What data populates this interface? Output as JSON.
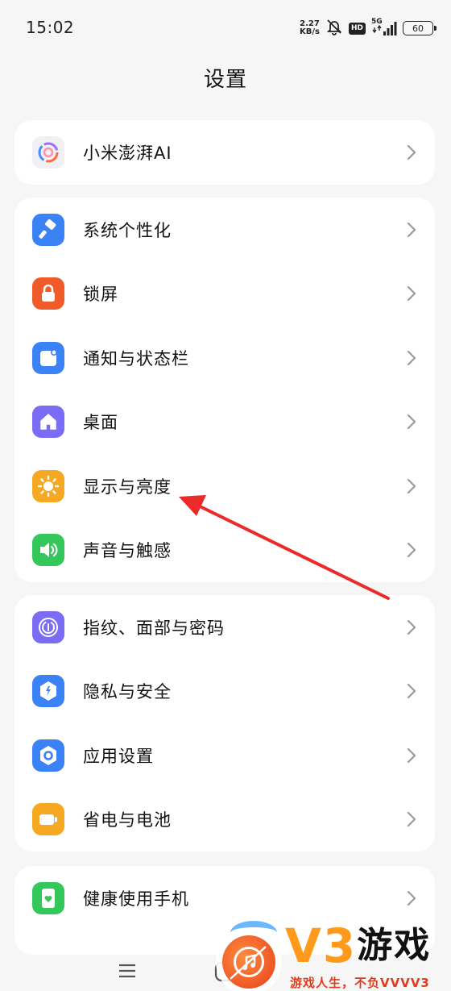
{
  "status_bar": {
    "time": "15:02",
    "speed_value": "2.27",
    "speed_unit": "KB/s",
    "hd_label": "HD",
    "network_label": "5G",
    "battery": "60"
  },
  "page_title": "设置",
  "groups": [
    {
      "items": [
        {
          "label": "小米澎湃AI",
          "icon": "hyperos-ai-icon",
          "color": "#f1f1f5"
        }
      ]
    },
    {
      "items": [
        {
          "label": "系统个性化",
          "icon": "theme-brush-icon",
          "color": "#3b82f6"
        },
        {
          "label": "锁屏",
          "icon": "lock-icon",
          "color": "#f15a29"
        },
        {
          "label": "通知与状态栏",
          "icon": "notification-icon",
          "color": "#3b82f6"
        },
        {
          "label": "桌面",
          "icon": "home-icon",
          "color": "#7b6cf6"
        },
        {
          "label": "显示与亮度",
          "icon": "sun-icon",
          "color": "#f7a823"
        },
        {
          "label": "声音与触感",
          "icon": "speaker-icon",
          "color": "#34c759"
        }
      ]
    },
    {
      "items": [
        {
          "label": "指纹、面部与密码",
          "icon": "fingerprint-icon",
          "color": "#7b6cf6"
        },
        {
          "label": "隐私与安全",
          "icon": "privacy-shield-icon",
          "color": "#3b82f6"
        },
        {
          "label": "应用设置",
          "icon": "app-settings-icon",
          "color": "#3b82f6"
        },
        {
          "label": "省电与电池",
          "icon": "battery-icon",
          "color": "#f7a823"
        }
      ]
    },
    {
      "items": [
        {
          "label": "健康使用手机",
          "icon": "wellbeing-icon",
          "color": "#34c759"
        }
      ]
    }
  ],
  "annotation": {
    "color": "#ec2a2a"
  },
  "watermark": {
    "brand_latin": "V3",
    "brand_cn": "游戏",
    "slogan": "游戏人生，不负VVVV3"
  }
}
